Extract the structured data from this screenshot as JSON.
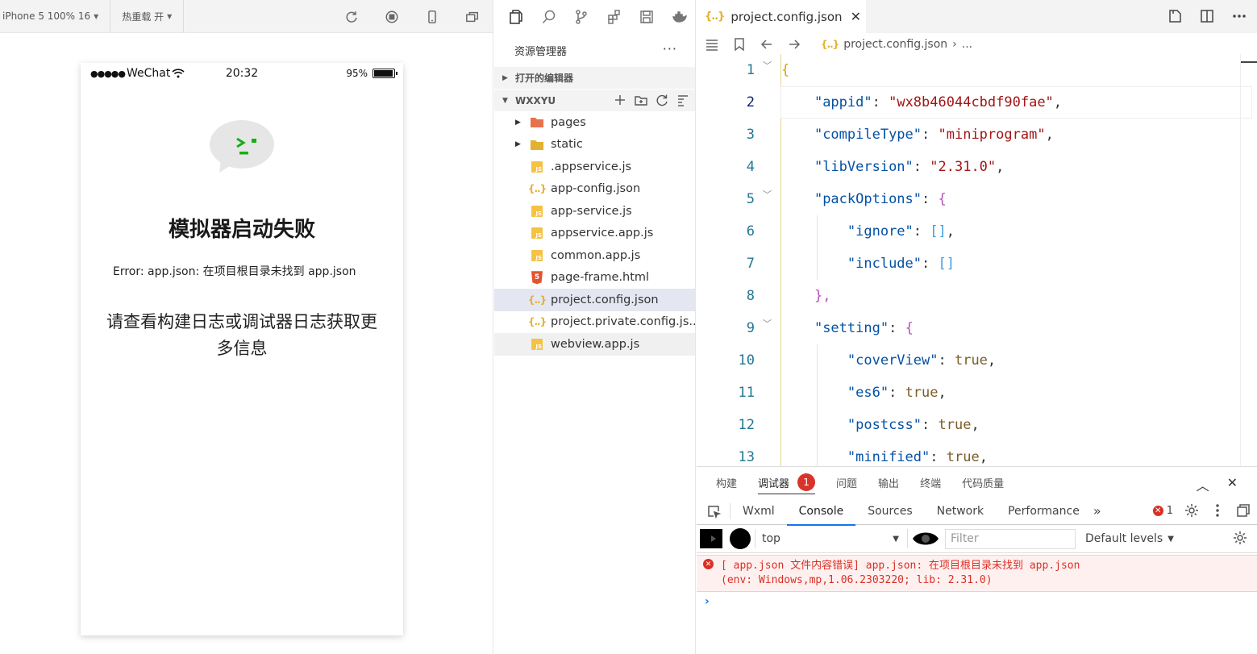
{
  "simulator": {
    "device_label": "iPhone 5 100% 16",
    "hot_reload_label": "热重载 开",
    "status": {
      "signal": "●●●●●",
      "carrier": "WeChat",
      "time": "20:32",
      "battery": "95%",
      "battery_level": 0.95
    },
    "error_title": "模拟器启动失败",
    "error_message": "Error: app.json: 在项目根目录未找到 app.json",
    "error_hint": "请查看构建日志或调试器日志获取更多信息"
  },
  "explorer": {
    "title": "资源管理器",
    "more": "···",
    "open_editors": "打开的编辑器",
    "project_name": "WXXYU",
    "items": [
      {
        "label": "pages",
        "type": "folder",
        "icon": "folder-pages-icon"
      },
      {
        "label": "static",
        "type": "folder",
        "icon": "folder-static-icon"
      },
      {
        "label": ".appservice.js",
        "type": "js"
      },
      {
        "label": "app-config.json",
        "type": "json"
      },
      {
        "label": "app-service.js",
        "type": "js"
      },
      {
        "label": "appservice.app.js",
        "type": "js"
      },
      {
        "label": "common.app.js",
        "type": "js"
      },
      {
        "label": "page-frame.html",
        "type": "html"
      },
      {
        "label": "project.config.json",
        "type": "json",
        "selected": true
      },
      {
        "label": "project.private.config.js...",
        "type": "json"
      },
      {
        "label": "webview.app.js",
        "type": "js"
      }
    ]
  },
  "editor": {
    "tab_label": "project.config.json",
    "breadcrumb_file": "project.config.json",
    "breadcrumb_more": "...",
    "json_icon_glyph": "{..}",
    "lines": [
      {
        "n": "1",
        "text": "{"
      },
      {
        "n": "2",
        "key": "\"appid\"",
        "value": "\"wx8b46044cbdf90fae\""
      },
      {
        "n": "3",
        "key": "\"compileType\"",
        "value": "\"miniprogram\""
      },
      {
        "n": "4",
        "key": "\"libVersion\"",
        "value": "\"2.31.0\""
      },
      {
        "n": "5",
        "key": "\"packOptions\"",
        "value": "{"
      },
      {
        "n": "6",
        "key": "\"ignore\"",
        "value": "[]"
      },
      {
        "n": "7",
        "key": "\"include\"",
        "value": "[]"
      },
      {
        "n": "8",
        "text": "},"
      },
      {
        "n": "9",
        "key": "\"setting\"",
        "value": "{"
      },
      {
        "n": "10",
        "key": "\"coverView\"",
        "value": "true"
      },
      {
        "n": "11",
        "key": "\"es6\"",
        "value": "true"
      },
      {
        "n": "12",
        "key": "\"postcss\"",
        "value": "true"
      },
      {
        "n": "13",
        "key": "\"minified\"",
        "value": "true"
      }
    ]
  },
  "panel": {
    "tabs": [
      "构建",
      "调试器",
      "问题",
      "输出",
      "终端",
      "代码质量"
    ],
    "debugger_badge": "1",
    "devtools_tabs": [
      "Wxml",
      "Console",
      "Sources",
      "Network",
      "Performance"
    ],
    "devtools_more": "»",
    "error_count": "1",
    "context": "top",
    "filter_placeholder": "Filter",
    "levels": "Default levels",
    "console_error_line1": "[ app.json 文件内容错误] app.json: 在项目根目录未找到 app.json",
    "console_error_line2": "(env: Windows,mp,1.06.2303220; lib: 2.31.0)",
    "prompt": "›"
  }
}
